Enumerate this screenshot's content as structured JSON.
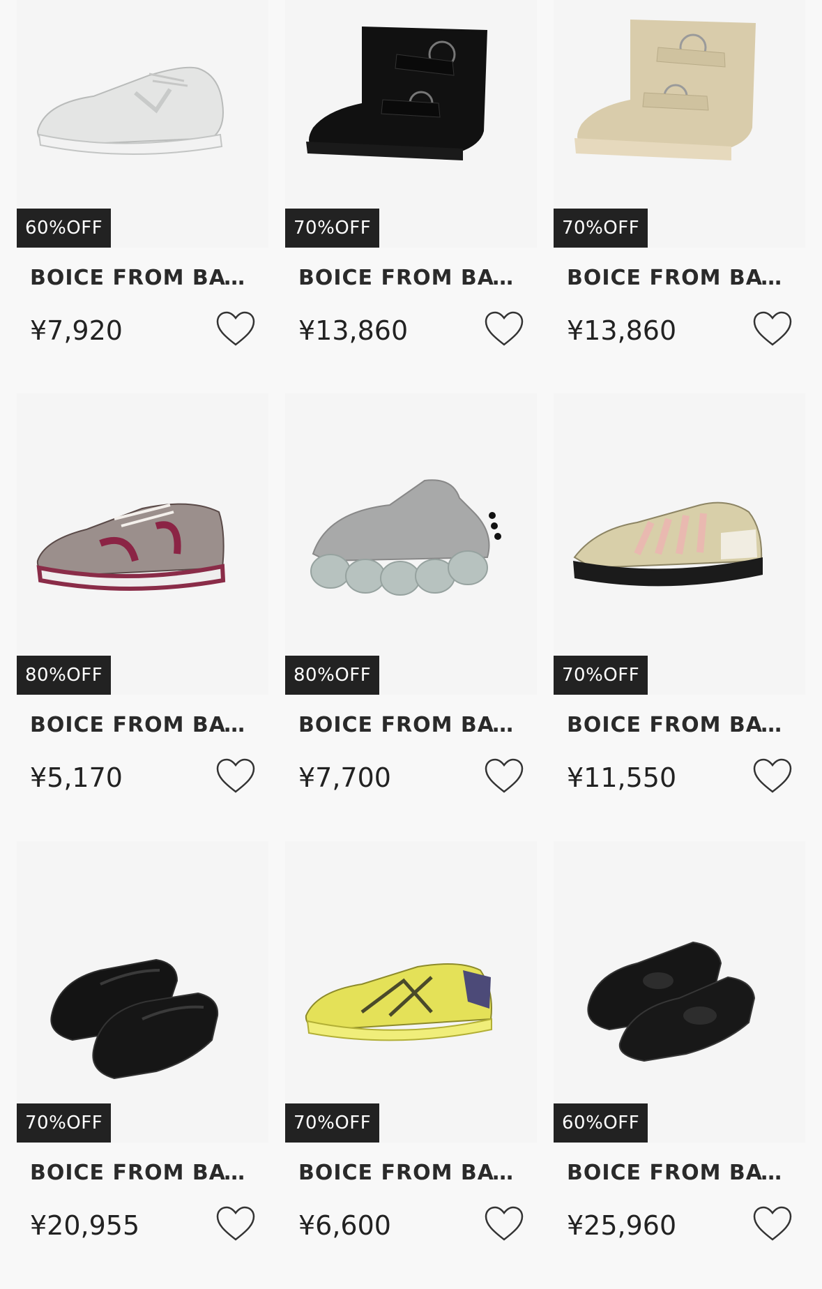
{
  "products": [
    {
      "badge": "60%OFF",
      "brand": "BOICE FROM BAY...",
      "price": "¥7,920",
      "icon": "heart-outline-icon",
      "shoe": "white-new-balance-sneaker"
    },
    {
      "badge": "70%OFF",
      "brand": "BOICE FROM BAY...",
      "price": "¥13,860",
      "icon": "heart-outline-icon",
      "shoe": "black-buckle-wallabee-boot"
    },
    {
      "badge": "70%OFF",
      "brand": "BOICE FROM BAY...",
      "price": "¥13,860",
      "icon": "heart-outline-icon",
      "shoe": "beige-buckle-wallabee-boot"
    },
    {
      "badge": "80%OFF",
      "brand": "BOICE FROM BAY...",
      "price": "¥5,170",
      "icon": "heart-outline-icon",
      "shoe": "grey-burgundy-saucony-sneaker"
    },
    {
      "badge": "80%OFF",
      "brand": "BOICE FROM BAY...",
      "price": "¥7,700",
      "icon": "heart-outline-icon",
      "shoe": "grey-bubble-sole-sneaker"
    },
    {
      "badge": "70%OFF",
      "brand": "BOICE FROM BAY...",
      "price": "¥11,550",
      "icon": "heart-outline-icon",
      "shoe": "beige-pink-trail-sneaker"
    },
    {
      "badge": "70%OFF",
      "brand": "BOICE FROM BAY...",
      "price": "¥20,955",
      "icon": "heart-outline-icon",
      "shoe": "black-mary-jane-shoes"
    },
    {
      "badge": "70%OFF",
      "brand": "BOICE FROM BAY...",
      "price": "¥6,600",
      "icon": "heart-outline-icon",
      "shoe": "yellow-asics-sneaker"
    },
    {
      "badge": "60%OFF",
      "brand": "BOICE FROM BAY...",
      "price": "¥25,960",
      "icon": "heart-outline-icon",
      "shoe": "black-strap-shoes"
    }
  ]
}
